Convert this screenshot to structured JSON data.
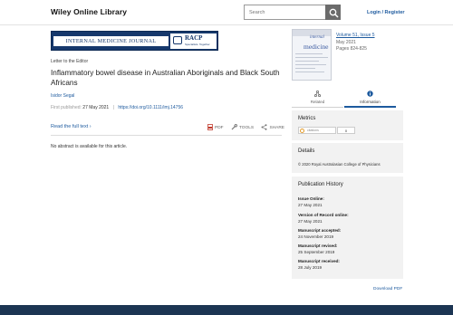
{
  "header": {
    "logo": "Wiley Online Library",
    "search_placeholder": "Search",
    "login_label": "Login / Register"
  },
  "journal_banner": {
    "name": "INTERNAL MEDICINE JOURNAL",
    "partner": "RACP",
    "partner_tagline": "Specialists. Together"
  },
  "article": {
    "category": "Letter to the Editor",
    "title": "Inflammatory bowel disease in Australian Aboriginals and Black South Africans",
    "author": "Isidor Segal",
    "published_label": "First published:",
    "published_date": "27 May 2021",
    "separator": "|",
    "doi": "https://doi.org/10.1111/imj.14756",
    "full_text_link": "Read the full text ›",
    "abstract_note": "No abstract is available for this article."
  },
  "tools": {
    "pdf": "PDF",
    "tools": "TOOLS",
    "share": "SHARE"
  },
  "issue": {
    "cover_word1": "internal",
    "cover_word2": "medicine",
    "volume_link": "Volume 51, Issue 5",
    "date": "May 2021",
    "pages": "Pages 824-825"
  },
  "tabs": [
    {
      "label": "Related",
      "icon": "related-icon",
      "active": false
    },
    {
      "label": "Information",
      "icon": "info-icon",
      "active": true
    }
  ],
  "metrics": {
    "heading": "Metrics",
    "badge_label": "citations",
    "count": "0"
  },
  "details": {
    "heading": "Details",
    "copyright": "© 2020 Royal Australasian College of Physicians"
  },
  "history": {
    "heading": "Publication History",
    "items": [
      {
        "label": "Issue Online:",
        "date": "27 May 2021"
      },
      {
        "label": "Version of Record online:",
        "date": "27 May 2021"
      },
      {
        "label": "Manuscript accepted:",
        "date": "24 November 2019"
      },
      {
        "label": "Manuscript revised:",
        "date": "25 September 2019"
      },
      {
        "label": "Manuscript received:",
        "date": "28 July 2019"
      }
    ]
  },
  "download_pdf": "Download PDF",
  "colors": {
    "link": "#1d5a9e",
    "banner": "#16386c",
    "footer": "#1c3553",
    "panel": "#f2f2f2"
  }
}
